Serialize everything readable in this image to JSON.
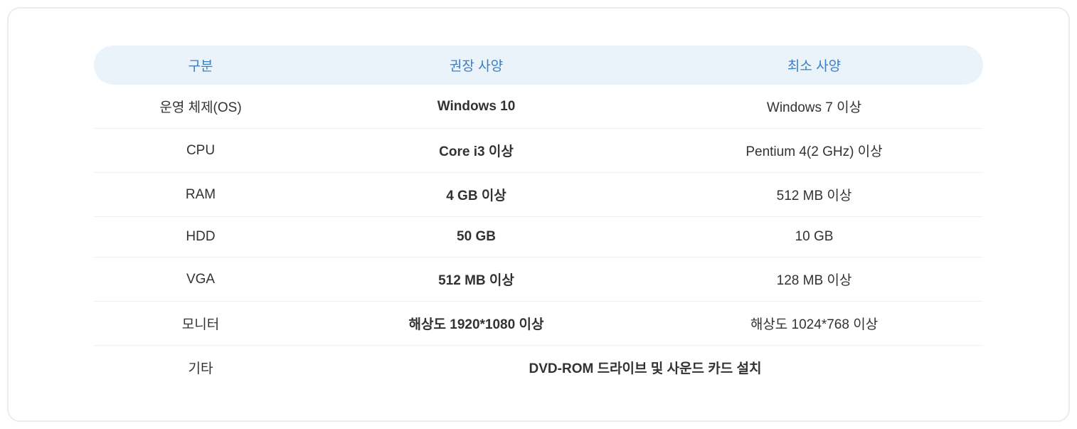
{
  "headers": {
    "category": "구분",
    "recommended": "권장 사양",
    "minimum": "최소 사양"
  },
  "rows": [
    {
      "category": "운영 체제(OS)",
      "recommended": "Windows 10",
      "minimum": "Windows 7 이상"
    },
    {
      "category": "CPU",
      "recommended": "Core i3 이상",
      "minimum": "Pentium 4(2 GHz) 이상"
    },
    {
      "category": "RAM",
      "recommended": "4 GB 이상",
      "minimum": "512 MB 이상"
    },
    {
      "category": "HDD",
      "recommended": "50 GB",
      "minimum": "10 GB"
    },
    {
      "category": "VGA",
      "recommended": "512 MB 이상",
      "minimum": "128 MB 이상"
    },
    {
      "category": "모니터",
      "recommended": "해상도 1920*1080 이상",
      "minimum": "해상도 1024*768 이상"
    }
  ],
  "final_row": {
    "category": "기타",
    "merged": "DVD-ROM 드라이브 및 사운드 카드 설치"
  }
}
